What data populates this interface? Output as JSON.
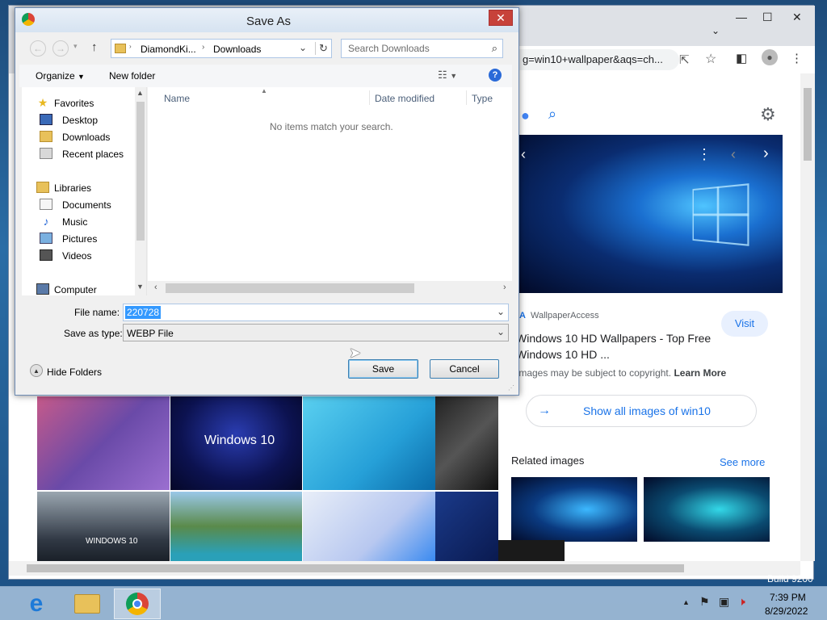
{
  "browser": {
    "omnibox_text": "g=win10+wallpaper&aqs=ch...",
    "panel": {
      "source": "WallpaperAccess",
      "visit_label": "Visit",
      "title_line1": "Windows 10 HD Wallpapers - Top Free",
      "title_line2": "Windows 10 HD ...",
      "copyright_text": "Images may be subject to copyright.",
      "learn_more": "Learn More",
      "show_all": "Show all images of win10",
      "related_label": "Related images",
      "see_more": "See more"
    },
    "thumb_text": {
      "win10": "Windows 10",
      "windows10_caps": "WINDOWS 10"
    },
    "desktop_watermark": "Build 9200"
  },
  "dialog": {
    "title": "Save As",
    "close_glyph": "✕",
    "breadcrumb": [
      "DiamondKi...",
      "Downloads"
    ],
    "search_placeholder": "Search Downloads",
    "organize_label": "Organize",
    "new_folder_label": "New folder",
    "nav": {
      "favorites": "Favorites",
      "desktop": "Desktop",
      "downloads": "Downloads",
      "recent": "Recent places",
      "libraries": "Libraries",
      "documents": "Documents",
      "music": "Music",
      "pictures": "Pictures",
      "videos": "Videos",
      "computer": "Computer"
    },
    "columns": {
      "name": "Name",
      "date": "Date modified",
      "type": "Type"
    },
    "empty_message": "No items match your search.",
    "file_name_label": "File name:",
    "file_name_value": "220728",
    "save_type_label": "Save as type:",
    "save_type_value": "WEBP File",
    "hide_folders_label": "Hide Folders",
    "save_button": "Save",
    "cancel_button": "Cancel"
  },
  "taskbar": {
    "time": "7:39 PM",
    "date": "8/29/2022"
  },
  "colors": {
    "dialog_bg": "#f0f0f0",
    "selection": "#3399ff",
    "link_blue": "#1a73e8",
    "close_red": "#c7423a"
  }
}
